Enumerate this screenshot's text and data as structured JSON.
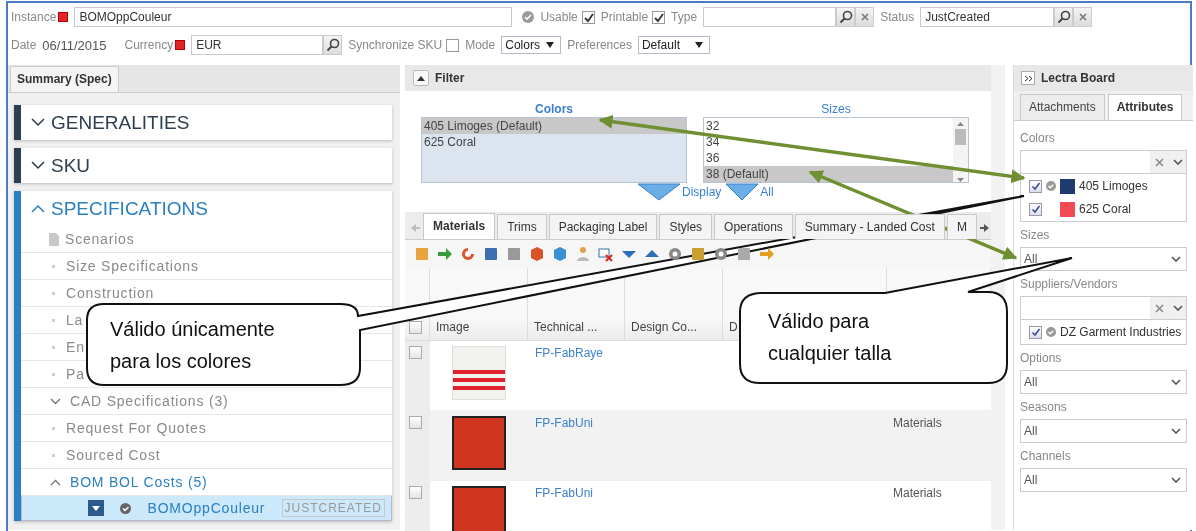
{
  "header": {
    "instance": {
      "label": "Instance",
      "value": "BOMOppCouleur",
      "required": true
    },
    "usable": {
      "label": "Usable",
      "checked": true
    },
    "printable": {
      "label": "Printable",
      "checked": true
    },
    "type": {
      "label": "Type"
    },
    "status": {
      "label": "Status",
      "value": "JustCreated"
    },
    "date": {
      "label": "Date",
      "value": "06/11/2015"
    },
    "currency": {
      "label": "Currency",
      "value": "EUR",
      "required": true
    },
    "synchronize": {
      "label": "Synchronize SKU",
      "checked": false
    },
    "mode": {
      "label": "Mode",
      "value": "Colors"
    },
    "preferences": {
      "label": "Preferences",
      "value": "Default"
    }
  },
  "left_panel": {
    "tab": "Summary (Spec)",
    "sections": [
      {
        "title": "GENERALITIES",
        "expanded": false
      },
      {
        "title": "SKU",
        "expanded": false
      },
      {
        "title": "SPECIFICATIONS",
        "expanded": true,
        "items": [
          {
            "label": "Scenarios",
            "kind": "doc"
          },
          {
            "label": "Size Specifications",
            "kind": "bullet"
          },
          {
            "label": "Construction",
            "kind": "bullet"
          },
          {
            "label": "La",
            "kind": "bullet"
          },
          {
            "label": "En",
            "kind": "bullet"
          },
          {
            "label": "Pa",
            "kind": "bullet"
          },
          {
            "label": "CAD Specifications (3)",
            "kind": "group",
            "expanded": false
          },
          {
            "label": "Request For Quotes",
            "kind": "bullet"
          },
          {
            "label": "Sourced Cost",
            "kind": "bullet"
          },
          {
            "label": "BOM BOL Costs (5)",
            "kind": "group",
            "expanded": true
          },
          {
            "label": "BOMOppCouleur",
            "kind": "entry",
            "status": "JUSTCREATED",
            "selected": true
          }
        ]
      }
    ]
  },
  "filter": {
    "title": "Filter",
    "colors": {
      "label": "Colors",
      "items": [
        {
          "label": "405 Limoges (Default)",
          "selected": true
        },
        {
          "label": "625 Coral",
          "selected": false
        }
      ]
    },
    "sizes": {
      "label": "Sizes",
      "items": [
        {
          "label": "32",
          "selected": false
        },
        {
          "label": "34",
          "selected": false
        },
        {
          "label": "36",
          "selected": false
        },
        {
          "label": "38 (Default)",
          "selected": true
        }
      ]
    },
    "display_link": "Display",
    "all_link": "All"
  },
  "tabs": [
    {
      "label": "Materials",
      "selected": true
    },
    {
      "label": "Trims",
      "selected": false
    },
    {
      "label": "Packaging Label",
      "selected": false
    },
    {
      "label": "Styles",
      "selected": false
    },
    {
      "label": "Operations",
      "selected": false
    },
    {
      "label": "Summary - Landed Cost",
      "selected": false
    },
    {
      "label": "M",
      "selected": false
    }
  ],
  "table": {
    "select_all_checked": false,
    "columns": [
      "Image",
      "Technical ...",
      "Design Co...",
      "D"
    ],
    "rows": [
      {
        "kind": "stripes",
        "checked": false,
        "technical": "FP-FabRaye"
      },
      {
        "kind": "solid",
        "checked": false,
        "technical": "FP-FabUni",
        "column_5": "Materials"
      },
      {
        "kind": "solid",
        "checked": false,
        "technical": "FP-FabUni",
        "column_5": "Materials"
      }
    ]
  },
  "right_panel": {
    "title": "Lectra Board",
    "tabs": [
      {
        "label": "Attachments",
        "selected": false
      },
      {
        "label": "Attributes",
        "selected": true
      }
    ],
    "colors": {
      "label": "Colors",
      "items": [
        {
          "label": "405 Limoges",
          "checked": true,
          "default": true,
          "color": "#1f3a6e"
        },
        {
          "label": "625 Coral",
          "checked": true,
          "default": false,
          "color": "#f44a55"
        }
      ]
    },
    "sizes": {
      "label": "Sizes",
      "value": "All"
    },
    "suppliers": {
      "label": "Suppliers/Vendors",
      "items": [
        {
          "label": "DZ Garment Industries",
          "checked": true,
          "default": true
        }
      ]
    },
    "options": {
      "label": "Options",
      "value": "All"
    },
    "seasons": {
      "label": "Seasons",
      "value": "All"
    },
    "channels": {
      "label": "Channels",
      "value": "All"
    }
  },
  "callouts": [
    {
      "text": "Válido únicamente\npara los colores"
    },
    {
      "text": "Válido para\ncualquier talla"
    }
  ]
}
